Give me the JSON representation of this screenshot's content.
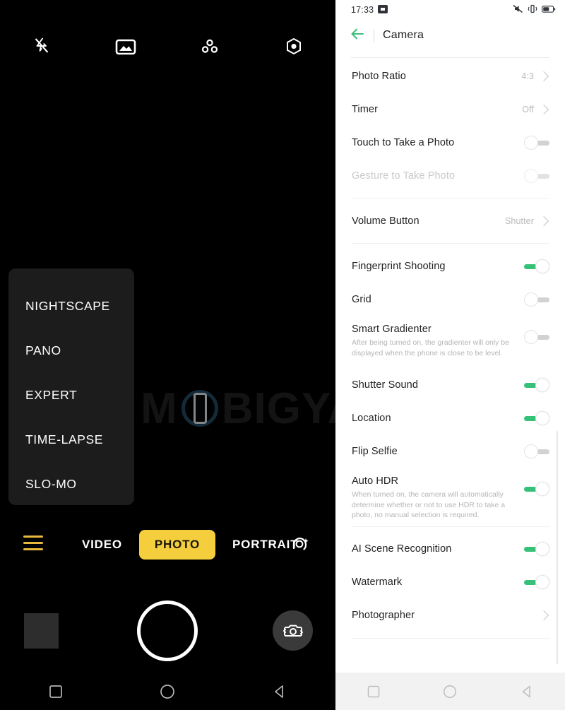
{
  "camera": {
    "topbar_icons": [
      {
        "name": "flash-off-icon",
        "label": "Flash off"
      },
      {
        "name": "hdr-image-icon",
        "label": "HDR"
      },
      {
        "name": "filters-icon",
        "label": "Filters"
      },
      {
        "name": "camera-settings-icon",
        "label": "Settings"
      }
    ],
    "mode_menu": {
      "items": [
        "NIGHTSCAPE",
        "PANO",
        "EXPERT",
        "TIME-LAPSE",
        "SLO-MO"
      ]
    },
    "mode_tabs": [
      {
        "label": "VIDEO",
        "active": false
      },
      {
        "label": "PHOTO",
        "active": true
      },
      {
        "label": "PORTRAIT",
        "active": false
      }
    ],
    "menu_icon": "hamburger-icon",
    "beauty_icon": "ai-beauty-icon",
    "shutter_button": "shutter-button",
    "gallery_thumb": "gallery-thumbnail",
    "flip_camera_icon": "flip-camera-icon",
    "accent_color": "#f5ce3e",
    "nav": [
      "recents-square-icon",
      "home-circle-icon",
      "back-triangle-icon"
    ]
  },
  "watermark": {
    "text_before": "M",
    "text_after": "BIGYAAN"
  },
  "settings": {
    "status_bar": {
      "time": "17:33",
      "left_icons": [
        "screenshot-icon"
      ],
      "right_icons": [
        "mute-icon",
        "vibrate-icon",
        "battery-icon"
      ]
    },
    "appbar": {
      "back_icon": "back-arrow-icon",
      "title": "Camera"
    },
    "groups": [
      {
        "rows": [
          {
            "label": "Photo Ratio",
            "type": "chevron",
            "value": "4:3",
            "disabled": false
          },
          {
            "label": "Timer",
            "type": "chevron",
            "value": "Off",
            "disabled": false
          },
          {
            "label": "Touch to Take a Photo",
            "type": "toggle",
            "state": "off",
            "disabled": false
          },
          {
            "label": "Gesture to Take Photo",
            "type": "toggle",
            "state": "off",
            "disabled": true
          }
        ]
      },
      {
        "rows": [
          {
            "label": "Volume Button",
            "type": "chevron",
            "value": "Shutter",
            "disabled": false
          }
        ]
      },
      {
        "rows": [
          {
            "label": "Fingerprint Shooting",
            "type": "toggle",
            "state": "on",
            "disabled": false
          },
          {
            "label": "Grid",
            "type": "toggle",
            "state": "off",
            "disabled": false
          },
          {
            "label": "Smart Gradienter",
            "type": "toggle",
            "state": "off",
            "disabled": false,
            "desc": "After being turned on, the gradienter will only be displayed when the phone is close to be level."
          },
          {
            "label": "Shutter Sound",
            "type": "toggle",
            "state": "on",
            "disabled": false
          },
          {
            "label": "Location",
            "type": "toggle",
            "state": "on",
            "disabled": false
          },
          {
            "label": "Flip Selfie",
            "type": "toggle",
            "state": "off",
            "disabled": false
          },
          {
            "label": "Auto HDR",
            "type": "toggle",
            "state": "on",
            "disabled": false,
            "desc": "When turned on, the camera will automatically determine whether or not to use HDR to take a photo, no manual selection is required."
          }
        ]
      },
      {
        "rows": [
          {
            "label": "AI Scene Recognition",
            "type": "toggle",
            "state": "on",
            "disabled": false
          },
          {
            "label": "Watermark",
            "type": "toggle",
            "state": "on",
            "disabled": false
          },
          {
            "label": "Photographer",
            "type": "chevron",
            "value": "",
            "disabled": false
          }
        ]
      }
    ],
    "nav": [
      "recents-square-icon",
      "home-circle-icon",
      "back-triangle-icon"
    ],
    "toggle_on_color": "#35c178",
    "accent_color": "#35c178"
  }
}
